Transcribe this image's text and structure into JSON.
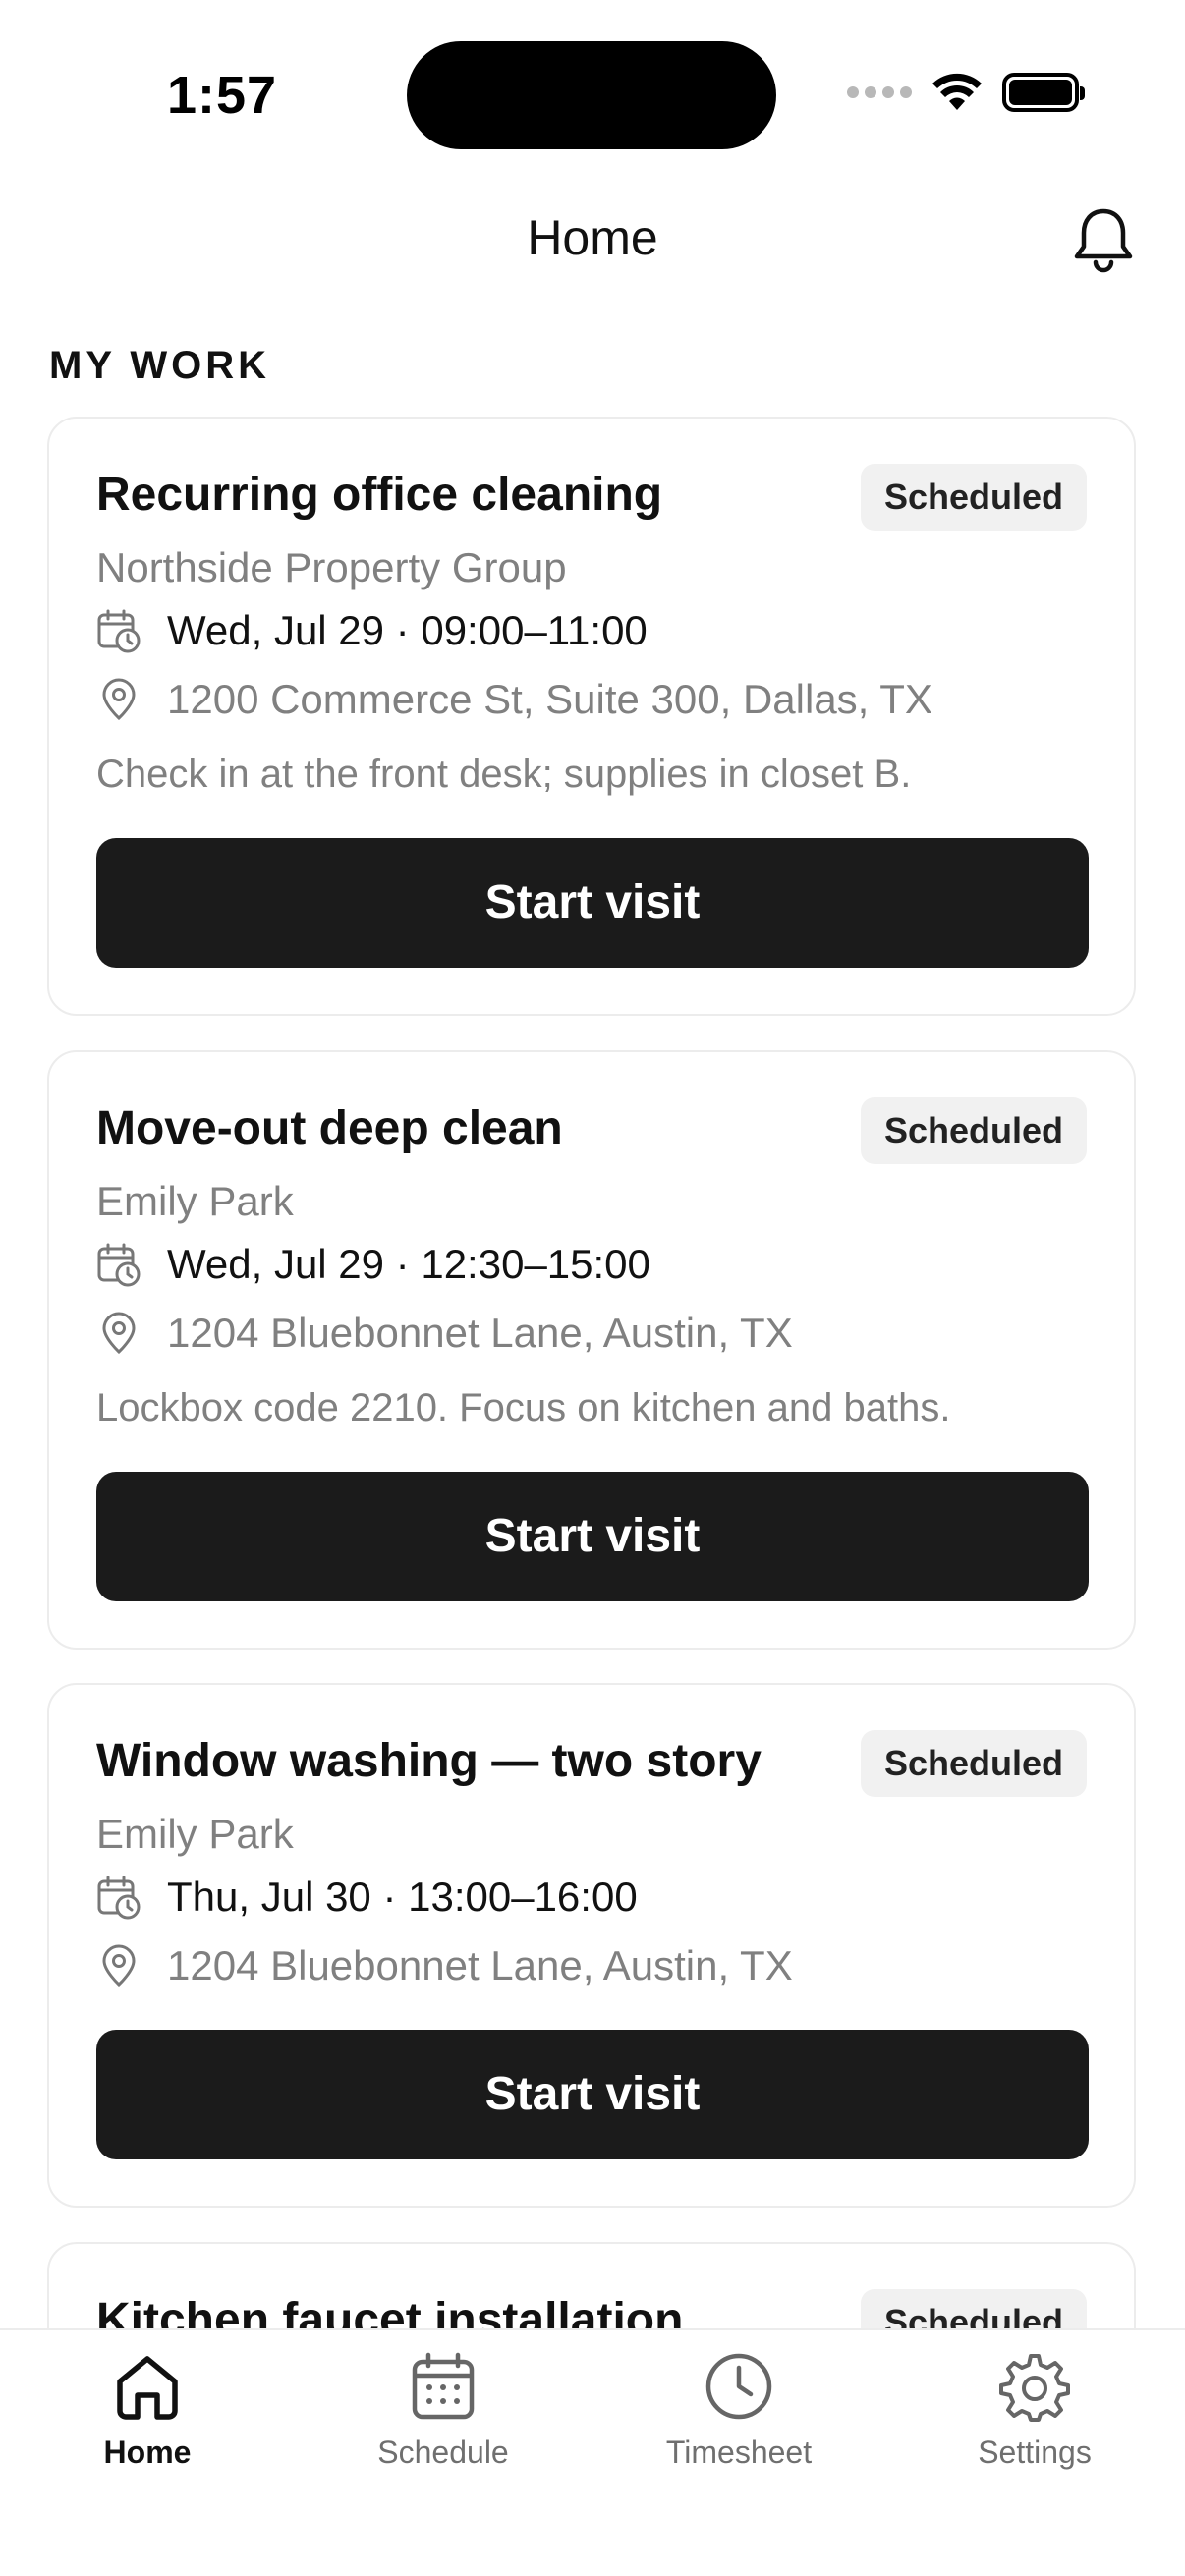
{
  "status": {
    "time": "1:57"
  },
  "header": {
    "title": "Home"
  },
  "section": {
    "label": "MY WORK"
  },
  "cards": [
    {
      "title": "Recurring office cleaning",
      "badge": "Scheduled",
      "client": "Northside Property Group",
      "datetime": "Wed, Jul 29 · 09:00–11:00",
      "address": "1200 Commerce St, Suite 300, Dallas, TX",
      "note": "Check in at the front desk; supplies in closet B.",
      "button": "Start visit"
    },
    {
      "title": "Move-out deep clean",
      "badge": "Scheduled",
      "client": "Emily Park",
      "datetime": "Wed, Jul 29 · 12:30–15:00",
      "address": "1204 Bluebonnet Lane, Austin, TX",
      "note": "Lockbox code 2210. Focus on kitchen and baths.",
      "button": "Start visit"
    },
    {
      "title": "Window washing — two story",
      "badge": "Scheduled",
      "client": "Emily Park",
      "datetime": "Thu, Jul 30 · 13:00–16:00",
      "address": "1204 Bluebonnet Lane, Austin, TX",
      "button": "Start visit"
    },
    {
      "title": "Kitchen faucet installation",
      "badge": "Scheduled"
    }
  ],
  "nav": [
    {
      "label": "Home",
      "icon": "home-icon"
    },
    {
      "label": "Schedule",
      "icon": "calendar-icon"
    },
    {
      "label": "Timesheet",
      "icon": "clock-icon"
    },
    {
      "label": "Settings",
      "icon": "gear-icon"
    }
  ]
}
